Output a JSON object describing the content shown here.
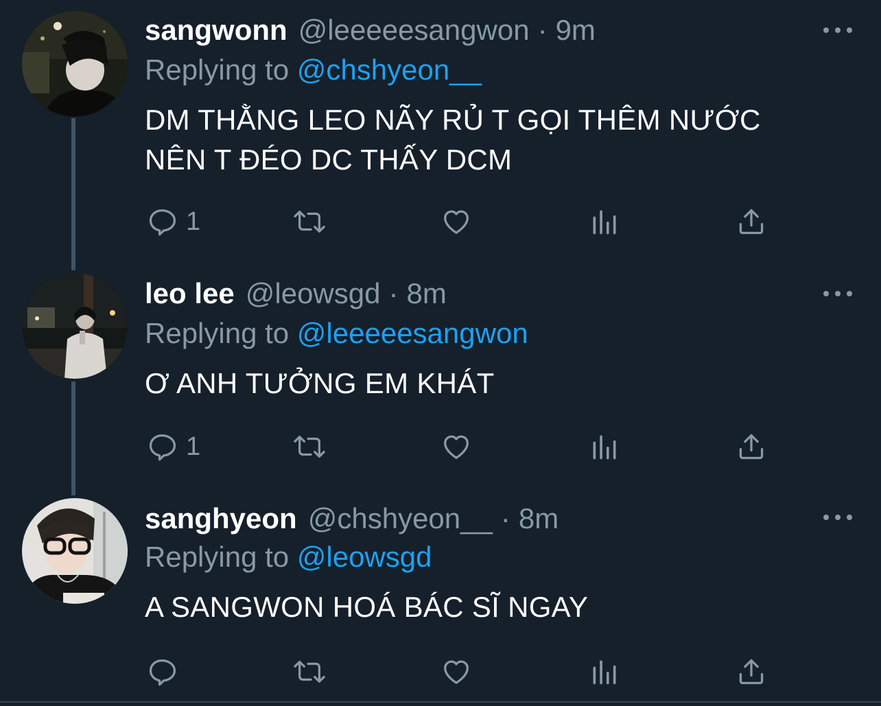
{
  "colors": {
    "background": "#15202b",
    "primary_text": "#ffffff",
    "secondary_text": "#8899a6",
    "link": "#1da1f2",
    "thread_line": "#3d5466"
  },
  "tweets": [
    {
      "display_name": "sangwonn",
      "handle": "@leeeeesangwon",
      "separator": "·",
      "time": "9m",
      "reply_prefix": "Replying to",
      "reply_target": "@chshyeon__",
      "text_lines": [
        "DM THẰNG LEO NÃY RỦ T GỌI THÊM NƯỚC",
        "NÊN T ĐÉO DC THẤY DCM"
      ],
      "reply_count": "1",
      "icons": [
        "comment-icon",
        "retweet-icon",
        "like-icon",
        "analytics-icon",
        "share-icon",
        "more-icon"
      ]
    },
    {
      "display_name": "leo lee",
      "handle": "@leowsgd",
      "separator": "·",
      "time": "8m",
      "reply_prefix": "Replying to",
      "reply_target": "@leeeeesangwon",
      "text_lines": [
        "Ơ ANH TƯỞNG EM KHÁT"
      ],
      "reply_count": "1",
      "icons": [
        "comment-icon",
        "retweet-icon",
        "like-icon",
        "analytics-icon",
        "share-icon",
        "more-icon"
      ]
    },
    {
      "display_name": "sanghyeon",
      "handle": "@chshyeon__",
      "separator": "·",
      "time": "8m",
      "reply_prefix": "Replying to",
      "reply_target": "@leowsgd",
      "text_lines": [
        "A SANGWON HOÁ BÁC SĨ NGAY"
      ],
      "reply_count": "",
      "icons": [
        "comment-icon",
        "retweet-icon",
        "like-icon",
        "analytics-icon",
        "share-icon",
        "more-icon"
      ]
    }
  ]
}
